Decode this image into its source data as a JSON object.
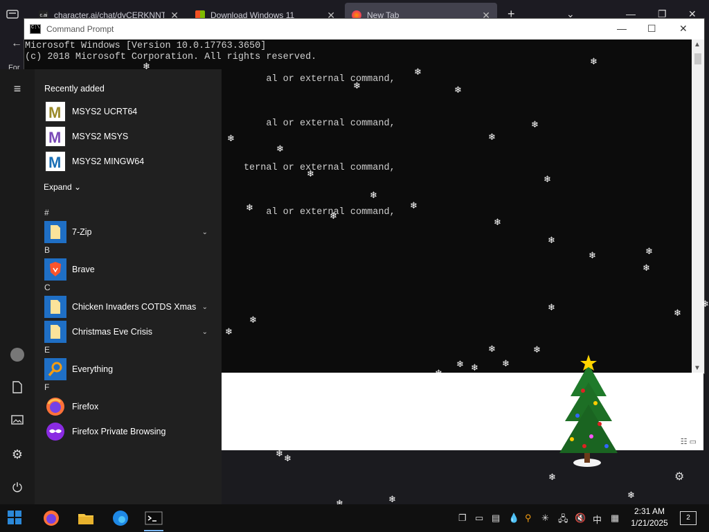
{
  "browser": {
    "tabs": [
      {
        "title": "character.ai/chat/dyCERKNNTa",
        "favicon_text": "c.ai"
      },
      {
        "title": "Download Windows 11",
        "favicon_text": ""
      },
      {
        "title": "New Tab",
        "favicon_text": ""
      }
    ],
    "new_tab_label": "+",
    "side_text": "For"
  },
  "cmd": {
    "title": "Command Prompt",
    "lines": [
      "Microsoft Windows [Version 10.0.17763.3650]",
      "(c) 2018 Microsoft Corporation. All rights reserved.",
      "",
      "                                           al or external command,",
      "",
      "",
      "",
      "                                           al or external command,",
      "",
      "",
      "",
      "                                       ternal or external command,",
      "",
      "",
      "",
      "                                           al or external command,"
    ]
  },
  "start_menu": {
    "recently_added_label": "Recently added",
    "recent": [
      {
        "label": "MSYS2 UCRT64",
        "color": "#9a8a2a"
      },
      {
        "label": "MSYS2 MSYS",
        "color": "#7a4ab8"
      },
      {
        "label": "MSYS2 MINGW64",
        "color": "#1a6fb5"
      }
    ],
    "expand_label": "Expand",
    "groups": [
      {
        "letter": "#",
        "items": [
          {
            "label": "7-Zip",
            "type": "folder",
            "chevron": true
          }
        ]
      },
      {
        "letter": "B",
        "items": [
          {
            "label": "Brave",
            "type": "brave",
            "chevron": false
          }
        ]
      },
      {
        "letter": "C",
        "items": [
          {
            "label": "Chicken Invaders COTDS Xmas",
            "type": "folder",
            "chevron": true
          },
          {
            "label": "Christmas Eve Crisis",
            "type": "folder",
            "chevron": true
          }
        ]
      },
      {
        "letter": "E",
        "items": [
          {
            "label": "Everything",
            "type": "everything",
            "chevron": false
          }
        ]
      },
      {
        "letter": "F",
        "items": [
          {
            "label": "Firefox",
            "type": "firefox",
            "chevron": false
          },
          {
            "label": "Firefox Private Browsing",
            "type": "firefox-private",
            "chevron": false
          }
        ]
      }
    ]
  },
  "taskbar": {
    "time": "2:31 AM",
    "date": "1/21/2025",
    "ime": "中",
    "notification_count": "2"
  }
}
